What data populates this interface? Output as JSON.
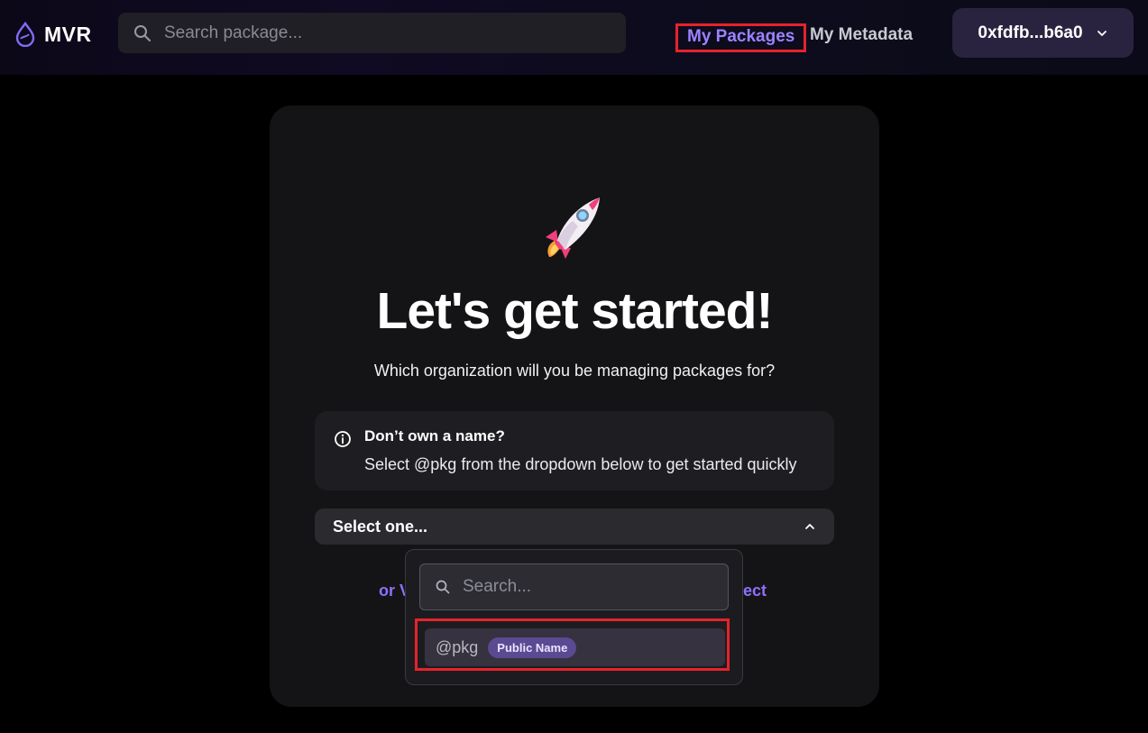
{
  "header": {
    "logo_text": "MVR",
    "search_placeholder": "Search package...",
    "nav": [
      {
        "label": "My Packages",
        "active": true
      },
      {
        "label": "My Metadata",
        "active": false
      }
    ],
    "wallet_label": "0xfdfb...b6a0"
  },
  "main": {
    "title": "Let's get started!",
    "subtitle": "Which organization will you be managing packages for?",
    "info_box": {
      "heading": "Don’t own a name?",
      "text": "Select @pkg from the dropdown below to get started quickly"
    },
    "select": {
      "placeholder": "Select one...",
      "expanded": true
    },
    "alt_link_left": "or V",
    "alt_link_right": "ject"
  },
  "dropdown": {
    "search_placeholder": "Search...",
    "options": [
      {
        "name": "@pkg",
        "badge": "Public Name"
      }
    ]
  },
  "colors": {
    "accent": "#9d82ff",
    "highlight_border": "#e5232b",
    "badge_bg": "#5a4a92"
  }
}
